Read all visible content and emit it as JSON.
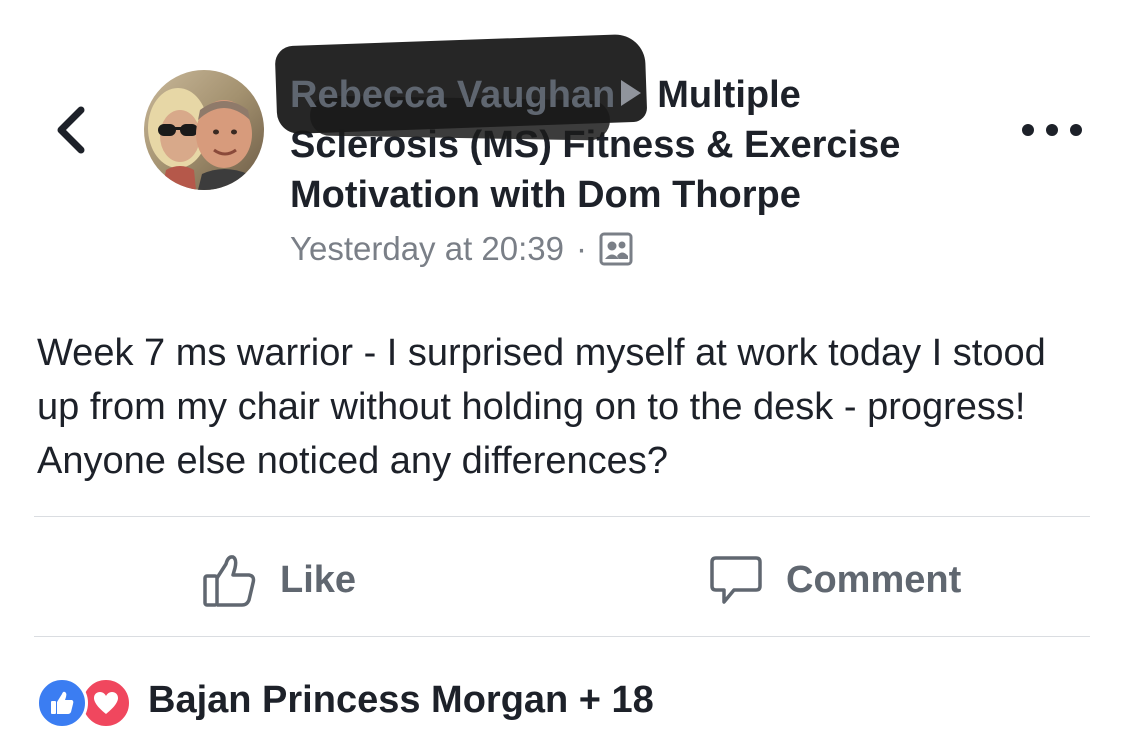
{
  "header": {
    "author_name": "Rebecca Vaughan",
    "group_name": "Multiple Sclerosis (MS) Fitness & Exercise Motivation with Dom Thorpe",
    "timestamp": "Yesterday at 20:39",
    "separator": "·",
    "privacy_icon": "group-members-icon",
    "back_icon": "chevron-left-icon",
    "more_icon": "ellipsis-icon"
  },
  "post": {
    "text": "Week 7 ms warrior - I surprised myself at work today I stood up from my chair without holding on to the desk - progress! Anyone else noticed any differences?"
  },
  "actions": {
    "like_label": "Like",
    "comment_label": "Comment"
  },
  "reactions": {
    "summary": "Bajan Princess Morgan + 18",
    "types": [
      "like",
      "love"
    ]
  },
  "colors": {
    "like_blue": "#3b7df2",
    "love_red": "#f0475e",
    "text_primary": "#1d2129",
    "text_secondary": "#7a7f87",
    "action_gray": "#606770",
    "divider": "#dadde1"
  }
}
